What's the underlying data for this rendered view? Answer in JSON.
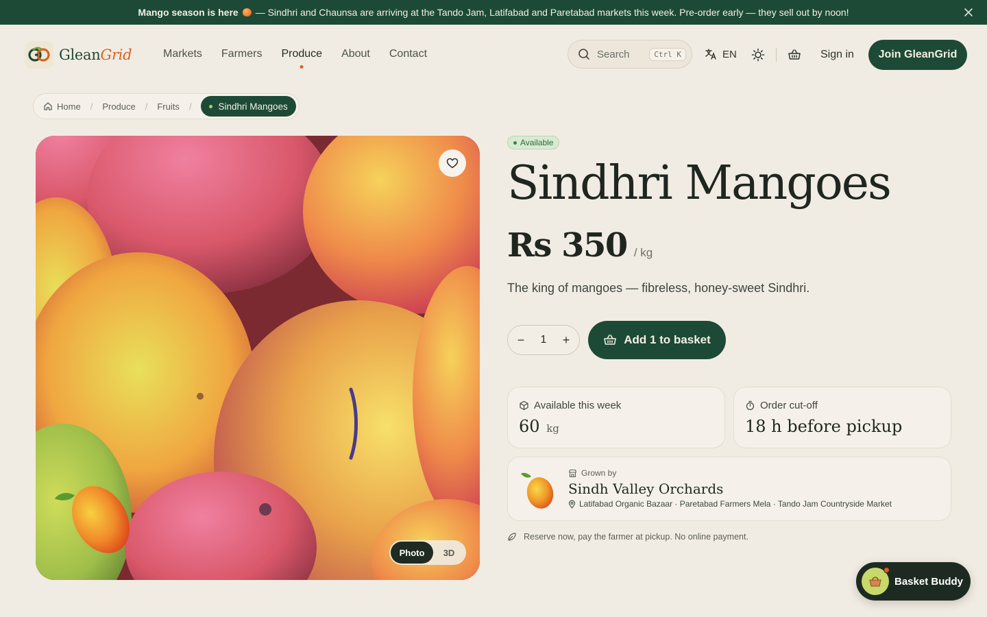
{
  "announcement": {
    "lead": "Mango season is here",
    "text": "— Sindhri and Chaunsa are arriving at the Tando Jam, Latifabad and Paretabad markets this week. Pre-order early — they sell out by noon!"
  },
  "brand": {
    "name_part1": "Glean",
    "name_part2": "Grid"
  },
  "nav": {
    "items": [
      {
        "label": "Markets"
      },
      {
        "label": "Farmers"
      },
      {
        "label": "Produce",
        "active": true
      },
      {
        "label": "About"
      },
      {
        "label": "Contact"
      }
    ]
  },
  "search": {
    "placeholder": "Search",
    "shortcut": "Ctrl K"
  },
  "language": "EN",
  "header": {
    "signin": "Sign in",
    "join": "Join GleanGrid"
  },
  "breadcrumb": {
    "home": "Home",
    "items": [
      "Produce",
      "Fruits"
    ],
    "current": "Sindhri Mangoes"
  },
  "gallery": {
    "view_options": [
      "Photo",
      "3D"
    ],
    "selected": "Photo"
  },
  "product": {
    "status": "Available",
    "title": "Sindhri Mangoes",
    "price": "Rs 350",
    "unit": "/ kg",
    "description": "The king of mangoes — fibreless, honey-sweet Sindhri.",
    "quantity": "1",
    "add_label": "Add 1 to basket"
  },
  "stats": {
    "availability": {
      "label": "Available this week",
      "value": "60",
      "unit": "kg"
    },
    "cutoff": {
      "label": "Order cut-off",
      "value": "18 h before pickup"
    }
  },
  "farmer": {
    "label": "Grown by",
    "name": "Sindh Valley Orchards",
    "markets": "Latifabad Organic Bazaar · Paretabad Farmers Mela · Tando Jam Countryside Market"
  },
  "note": "Reserve now, pay the farmer at pickup. No online payment.",
  "assistant": {
    "label": "Basket Buddy"
  },
  "colors": {
    "primary": "#1d4a36",
    "accent": "#d9621d",
    "background": "#f1ece3"
  }
}
